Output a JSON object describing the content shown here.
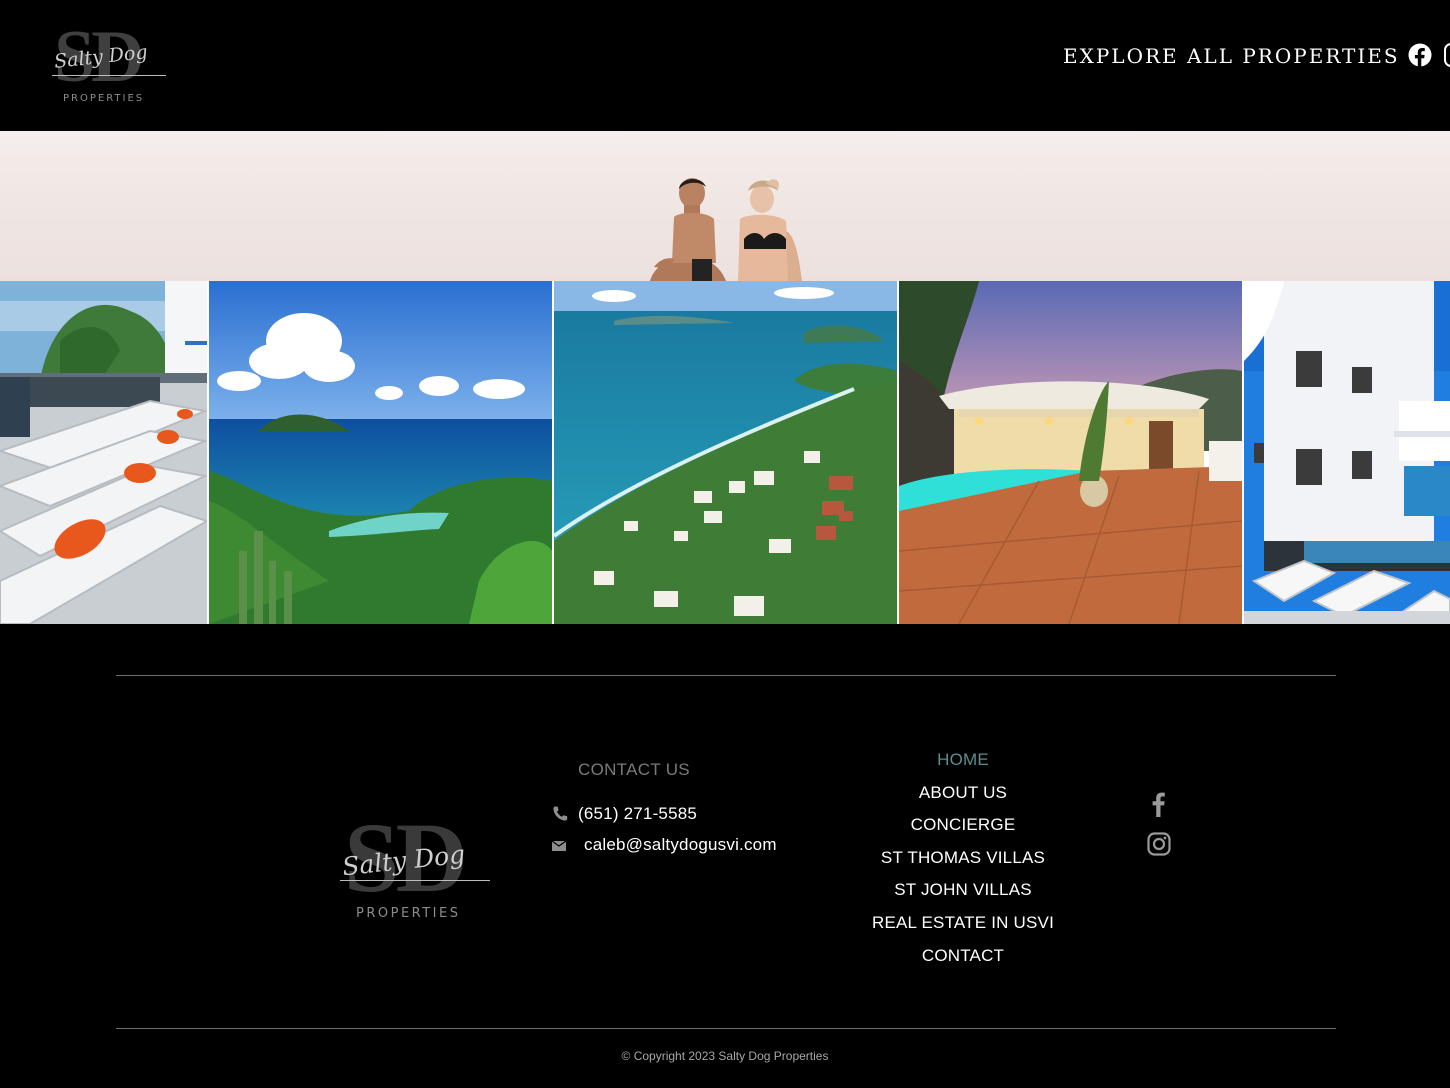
{
  "header": {
    "logo": {
      "monogram": "SD",
      "script": "Salty Dog",
      "subtitle": "PROPERTIES"
    },
    "nav_link": "EXPLORE ALL PROPERTIES",
    "social_icons": [
      "facebook-icon",
      "instagram-icon"
    ]
  },
  "hero": {
    "image": "couple-on-beach-photo"
  },
  "gallery": {
    "images": [
      "pool-loungers-photo",
      "bay-island-view-photo",
      "aerial-coastline-villas-photo",
      "villa-pool-terrace-dusk-photo",
      "white-villa-exterior-photo"
    ]
  },
  "footer": {
    "logo": {
      "monogram": "SD",
      "script": "Salty Dog",
      "subtitle": "PROPERTIES"
    },
    "contact": {
      "title": "CONTACT US",
      "phone": "(651) 271-5585",
      "email": "caleb@saltydogusvi.com",
      "phone_icon": "phone-icon",
      "email_icon": "mail-icon"
    },
    "nav": {
      "home": "HOME",
      "about": "ABOUT US",
      "concierge": "CONCIERGE",
      "st_thomas": "ST THOMAS VILLAS",
      "st_john": "ST JOHN VILLAS",
      "real_estate": "REAL ESTATE IN USVI",
      "contact": "CONTACT"
    },
    "active_color": "#5a8f92",
    "social_icons": [
      "facebook-icon",
      "instagram-icon"
    ],
    "copyright": "© Copyright 2023 Salty Dog Properties"
  }
}
